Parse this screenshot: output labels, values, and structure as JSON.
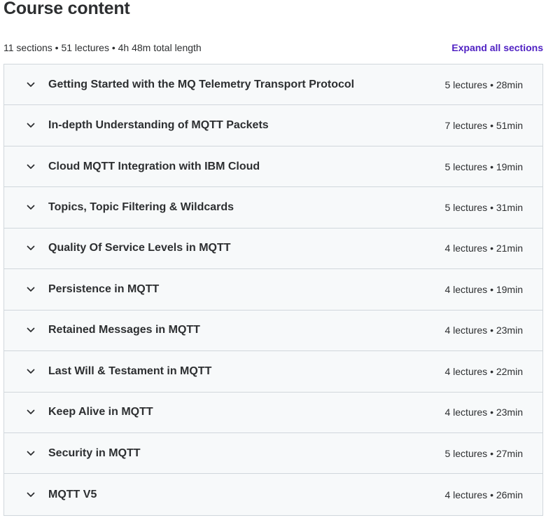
{
  "page": {
    "title": "Course content",
    "summary": "11 sections • 51 lectures • 4h 48m total length",
    "expand_label": "Expand all sections"
  },
  "colors": {
    "accent": "#5022c3",
    "row_bg": "#f7f9fa",
    "border": "#d1d7dc",
    "text": "#2d2f31"
  },
  "icons": {
    "section_toggle": "chevron-down-icon"
  },
  "sections": [
    {
      "title": "Getting Started with the MQ Telemetry Transport Protocol",
      "info": "5 lectures • 28min"
    },
    {
      "title": "In-depth Understanding of MQTT Packets",
      "info": "7 lectures • 51min"
    },
    {
      "title": "Cloud MQTT Integration with IBM Cloud",
      "info": "5 lectures • 19min"
    },
    {
      "title": "Topics, Topic Filtering & Wildcards",
      "info": "5 lectures • 31min"
    },
    {
      "title": "Quality Of Service Levels in MQTT",
      "info": "4 lectures • 21min"
    },
    {
      "title": "Persistence in MQTT",
      "info": "4 lectures • 19min"
    },
    {
      "title": "Retained Messages in MQTT",
      "info": "4 lectures • 23min"
    },
    {
      "title": "Last Will & Testament in MQTT",
      "info": "4 lectures • 22min"
    },
    {
      "title": "Keep Alive in MQTT",
      "info": "4 lectures • 23min"
    },
    {
      "title": "Security in MQTT",
      "info": "5 lectures • 27min"
    },
    {
      "title": "MQTT V5",
      "info": "4 lectures • 26min"
    }
  ]
}
